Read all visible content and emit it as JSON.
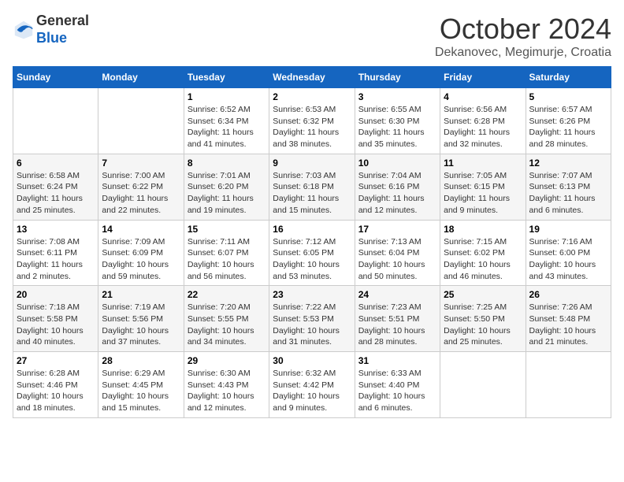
{
  "header": {
    "logo_general": "General",
    "logo_blue": "Blue",
    "month_title": "October 2024",
    "location": "Dekanovec, Megimurje, Croatia"
  },
  "days_of_week": [
    "Sunday",
    "Monday",
    "Tuesday",
    "Wednesday",
    "Thursday",
    "Friday",
    "Saturday"
  ],
  "weeks": [
    [
      {
        "day": "",
        "sunrise": "",
        "sunset": "",
        "daylight": ""
      },
      {
        "day": "",
        "sunrise": "",
        "sunset": "",
        "daylight": ""
      },
      {
        "day": "1",
        "sunrise": "Sunrise: 6:52 AM",
        "sunset": "Sunset: 6:34 PM",
        "daylight": "Daylight: 11 hours and 41 minutes."
      },
      {
        "day": "2",
        "sunrise": "Sunrise: 6:53 AM",
        "sunset": "Sunset: 6:32 PM",
        "daylight": "Daylight: 11 hours and 38 minutes."
      },
      {
        "day": "3",
        "sunrise": "Sunrise: 6:55 AM",
        "sunset": "Sunset: 6:30 PM",
        "daylight": "Daylight: 11 hours and 35 minutes."
      },
      {
        "day": "4",
        "sunrise": "Sunrise: 6:56 AM",
        "sunset": "Sunset: 6:28 PM",
        "daylight": "Daylight: 11 hours and 32 minutes."
      },
      {
        "day": "5",
        "sunrise": "Sunrise: 6:57 AM",
        "sunset": "Sunset: 6:26 PM",
        "daylight": "Daylight: 11 hours and 28 minutes."
      }
    ],
    [
      {
        "day": "6",
        "sunrise": "Sunrise: 6:58 AM",
        "sunset": "Sunset: 6:24 PM",
        "daylight": "Daylight: 11 hours and 25 minutes."
      },
      {
        "day": "7",
        "sunrise": "Sunrise: 7:00 AM",
        "sunset": "Sunset: 6:22 PM",
        "daylight": "Daylight: 11 hours and 22 minutes."
      },
      {
        "day": "8",
        "sunrise": "Sunrise: 7:01 AM",
        "sunset": "Sunset: 6:20 PM",
        "daylight": "Daylight: 11 hours and 19 minutes."
      },
      {
        "day": "9",
        "sunrise": "Sunrise: 7:03 AM",
        "sunset": "Sunset: 6:18 PM",
        "daylight": "Daylight: 11 hours and 15 minutes."
      },
      {
        "day": "10",
        "sunrise": "Sunrise: 7:04 AM",
        "sunset": "Sunset: 6:16 PM",
        "daylight": "Daylight: 11 hours and 12 minutes."
      },
      {
        "day": "11",
        "sunrise": "Sunrise: 7:05 AM",
        "sunset": "Sunset: 6:15 PM",
        "daylight": "Daylight: 11 hours and 9 minutes."
      },
      {
        "day": "12",
        "sunrise": "Sunrise: 7:07 AM",
        "sunset": "Sunset: 6:13 PM",
        "daylight": "Daylight: 11 hours and 6 minutes."
      }
    ],
    [
      {
        "day": "13",
        "sunrise": "Sunrise: 7:08 AM",
        "sunset": "Sunset: 6:11 PM",
        "daylight": "Daylight: 11 hours and 2 minutes."
      },
      {
        "day": "14",
        "sunrise": "Sunrise: 7:09 AM",
        "sunset": "Sunset: 6:09 PM",
        "daylight": "Daylight: 10 hours and 59 minutes."
      },
      {
        "day": "15",
        "sunrise": "Sunrise: 7:11 AM",
        "sunset": "Sunset: 6:07 PM",
        "daylight": "Daylight: 10 hours and 56 minutes."
      },
      {
        "day": "16",
        "sunrise": "Sunrise: 7:12 AM",
        "sunset": "Sunset: 6:05 PM",
        "daylight": "Daylight: 10 hours and 53 minutes."
      },
      {
        "day": "17",
        "sunrise": "Sunrise: 7:13 AM",
        "sunset": "Sunset: 6:04 PM",
        "daylight": "Daylight: 10 hours and 50 minutes."
      },
      {
        "day": "18",
        "sunrise": "Sunrise: 7:15 AM",
        "sunset": "Sunset: 6:02 PM",
        "daylight": "Daylight: 10 hours and 46 minutes."
      },
      {
        "day": "19",
        "sunrise": "Sunrise: 7:16 AM",
        "sunset": "Sunset: 6:00 PM",
        "daylight": "Daylight: 10 hours and 43 minutes."
      }
    ],
    [
      {
        "day": "20",
        "sunrise": "Sunrise: 7:18 AM",
        "sunset": "Sunset: 5:58 PM",
        "daylight": "Daylight: 10 hours and 40 minutes."
      },
      {
        "day": "21",
        "sunrise": "Sunrise: 7:19 AM",
        "sunset": "Sunset: 5:56 PM",
        "daylight": "Daylight: 10 hours and 37 minutes."
      },
      {
        "day": "22",
        "sunrise": "Sunrise: 7:20 AM",
        "sunset": "Sunset: 5:55 PM",
        "daylight": "Daylight: 10 hours and 34 minutes."
      },
      {
        "day": "23",
        "sunrise": "Sunrise: 7:22 AM",
        "sunset": "Sunset: 5:53 PM",
        "daylight": "Daylight: 10 hours and 31 minutes."
      },
      {
        "day": "24",
        "sunrise": "Sunrise: 7:23 AM",
        "sunset": "Sunset: 5:51 PM",
        "daylight": "Daylight: 10 hours and 28 minutes."
      },
      {
        "day": "25",
        "sunrise": "Sunrise: 7:25 AM",
        "sunset": "Sunset: 5:50 PM",
        "daylight": "Daylight: 10 hours and 25 minutes."
      },
      {
        "day": "26",
        "sunrise": "Sunrise: 7:26 AM",
        "sunset": "Sunset: 5:48 PM",
        "daylight": "Daylight: 10 hours and 21 minutes."
      }
    ],
    [
      {
        "day": "27",
        "sunrise": "Sunrise: 6:28 AM",
        "sunset": "Sunset: 4:46 PM",
        "daylight": "Daylight: 10 hours and 18 minutes."
      },
      {
        "day": "28",
        "sunrise": "Sunrise: 6:29 AM",
        "sunset": "Sunset: 4:45 PM",
        "daylight": "Daylight: 10 hours and 15 minutes."
      },
      {
        "day": "29",
        "sunrise": "Sunrise: 6:30 AM",
        "sunset": "Sunset: 4:43 PM",
        "daylight": "Daylight: 10 hours and 12 minutes."
      },
      {
        "day": "30",
        "sunrise": "Sunrise: 6:32 AM",
        "sunset": "Sunset: 4:42 PM",
        "daylight": "Daylight: 10 hours and 9 minutes."
      },
      {
        "day": "31",
        "sunrise": "Sunrise: 6:33 AM",
        "sunset": "Sunset: 4:40 PM",
        "daylight": "Daylight: 10 hours and 6 minutes."
      },
      {
        "day": "",
        "sunrise": "",
        "sunset": "",
        "daylight": ""
      },
      {
        "day": "",
        "sunrise": "",
        "sunset": "",
        "daylight": ""
      }
    ]
  ]
}
